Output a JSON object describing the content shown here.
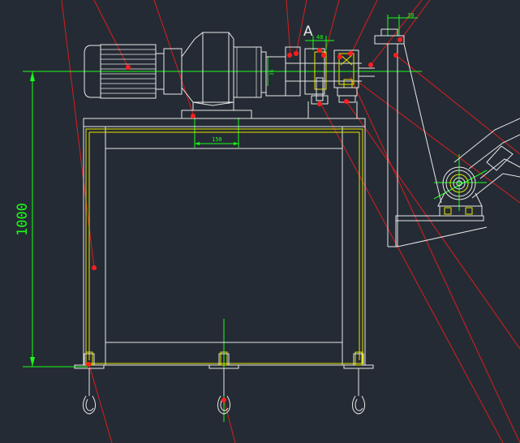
{
  "drawing": {
    "dimensions": {
      "overall_height": "1000",
      "base_width": "150",
      "top_offset": "30",
      "small_a": "48",
      "small_b": "35"
    },
    "section_label": "A"
  },
  "colors": {
    "background": "#252b34",
    "outline": "#e8e8e8",
    "hidden": "#e6e600",
    "dimension": "#19ff19",
    "leader": "#d81e1e",
    "marker": "#ff1e1e"
  }
}
